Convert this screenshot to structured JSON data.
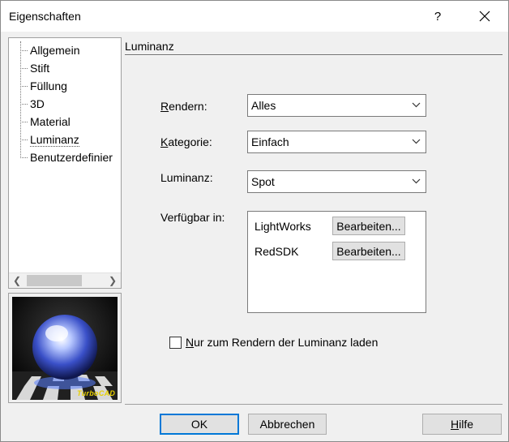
{
  "window": {
    "title": "Eigenschaften",
    "help_label": "?"
  },
  "tree": {
    "items": [
      {
        "label": "Allgemein"
      },
      {
        "label": "Stift"
      },
      {
        "label": "Füllung"
      },
      {
        "label": "3D"
      },
      {
        "label": "Material"
      },
      {
        "label": "Luminanz",
        "selected": true
      },
      {
        "label": "Benutzerdefinier"
      }
    ]
  },
  "preview": {
    "logo_text": "TurboCAD"
  },
  "section": {
    "title": "Luminanz"
  },
  "form": {
    "rendern": {
      "mnemonic": "R",
      "rest": "endern:",
      "value": "Alles"
    },
    "kategorie": {
      "mnemonic": "K",
      "rest": "ategorie:",
      "value": "Einfach"
    },
    "luminanz": {
      "label": "Luminanz:",
      "value": "Spot"
    },
    "verfuegbar": {
      "label": "Verfügbar in:",
      "rows": [
        {
          "name": "LightWorks",
          "button": "Bearbeiten..."
        },
        {
          "name": "RedSDK",
          "button": "Bearbeiten..."
        }
      ]
    },
    "checkbox": {
      "mnemonic": "N",
      "rest": "ur zum Rendern der Luminanz laden",
      "checked": false
    }
  },
  "buttons": {
    "ok": "OK",
    "cancel": "Abbrechen",
    "help_mnemonic": "H",
    "help_rest": "ilfe"
  }
}
